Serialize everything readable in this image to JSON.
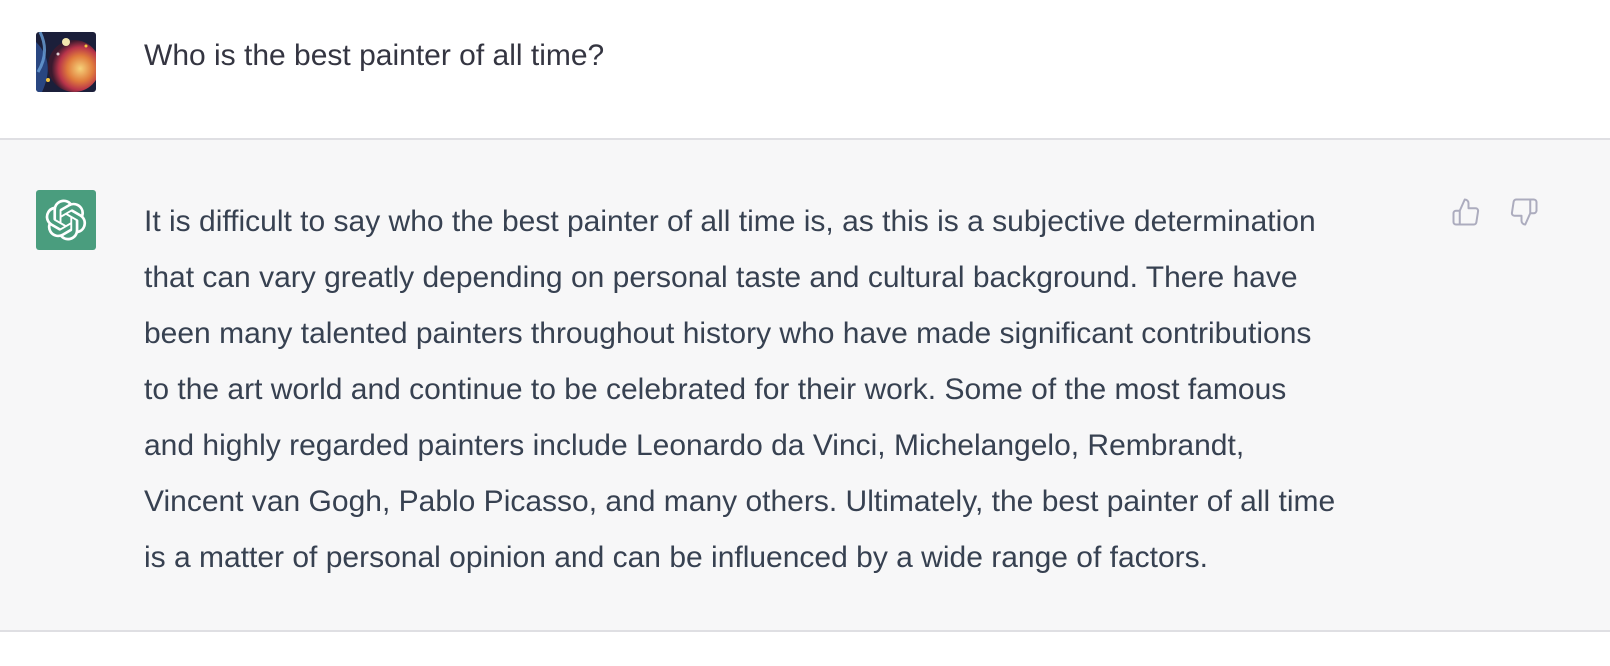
{
  "thread": {
    "user_message": {
      "avatar_icon": "user-avatar-painting-icon",
      "text": "Who is the best painter of all time?"
    },
    "assistant_message": {
      "avatar_icon": "openai-logo-icon",
      "avatar_color": "#4a9d7e",
      "lines": [
        "It is difficult to say who the best painter of all time is, as this is a subjective determination",
        "that can vary greatly depending on personal taste and cultural background. There have",
        "been many talented painters throughout history who have made significant contributions",
        "to the art world and continue to be celebrated for their work. Some of the most famous",
        "and highly regarded painters include Leonardo da Vinci, Michelangelo, Rembrandt,",
        "Vincent van Gogh, Pablo Picasso, and many others. Ultimately, the best painter of all time",
        "is a matter of personal opinion and can be influenced by a wide range of factors."
      ],
      "feedback": {
        "thumbs_up_icon": "thumbs-up-icon",
        "thumbs_down_icon": "thumbs-down-icon"
      }
    }
  },
  "colors": {
    "user_bg": "#ffffff",
    "assistant_bg": "#f7f7f8",
    "text": "#374151",
    "divider": "#dfdfe3",
    "icon": "#acacbe"
  }
}
